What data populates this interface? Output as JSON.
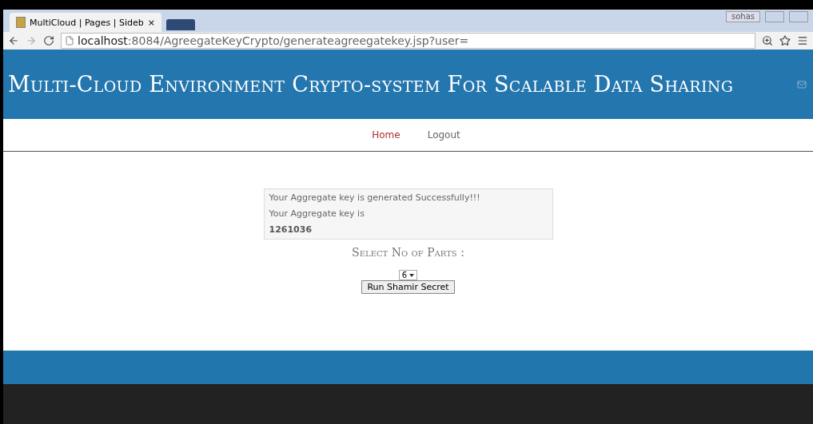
{
  "browser": {
    "tab_title": "MultiCloud | Pages | Sideb",
    "tab_close": "×",
    "profile": "sohas",
    "url_host": "localhost",
    "url_path": ":8084/AgreegateKeyCrypto/generateagreegatekey.jsp?user="
  },
  "header": {
    "title": "Multi-Cloud Environment Crypto-system For Scalable Data Sharing"
  },
  "nav": [
    {
      "label": "Home",
      "selected": true
    },
    {
      "label": "Logout",
      "selected": false
    }
  ],
  "result": {
    "lines": [
      "Your Aggregate key is generated Successfully!!!",
      "Your Aggregate key is"
    ],
    "key": "1261036"
  },
  "parts": {
    "label": "Select No of Parts :",
    "value": "6",
    "button": "Run Shamir Secret"
  }
}
